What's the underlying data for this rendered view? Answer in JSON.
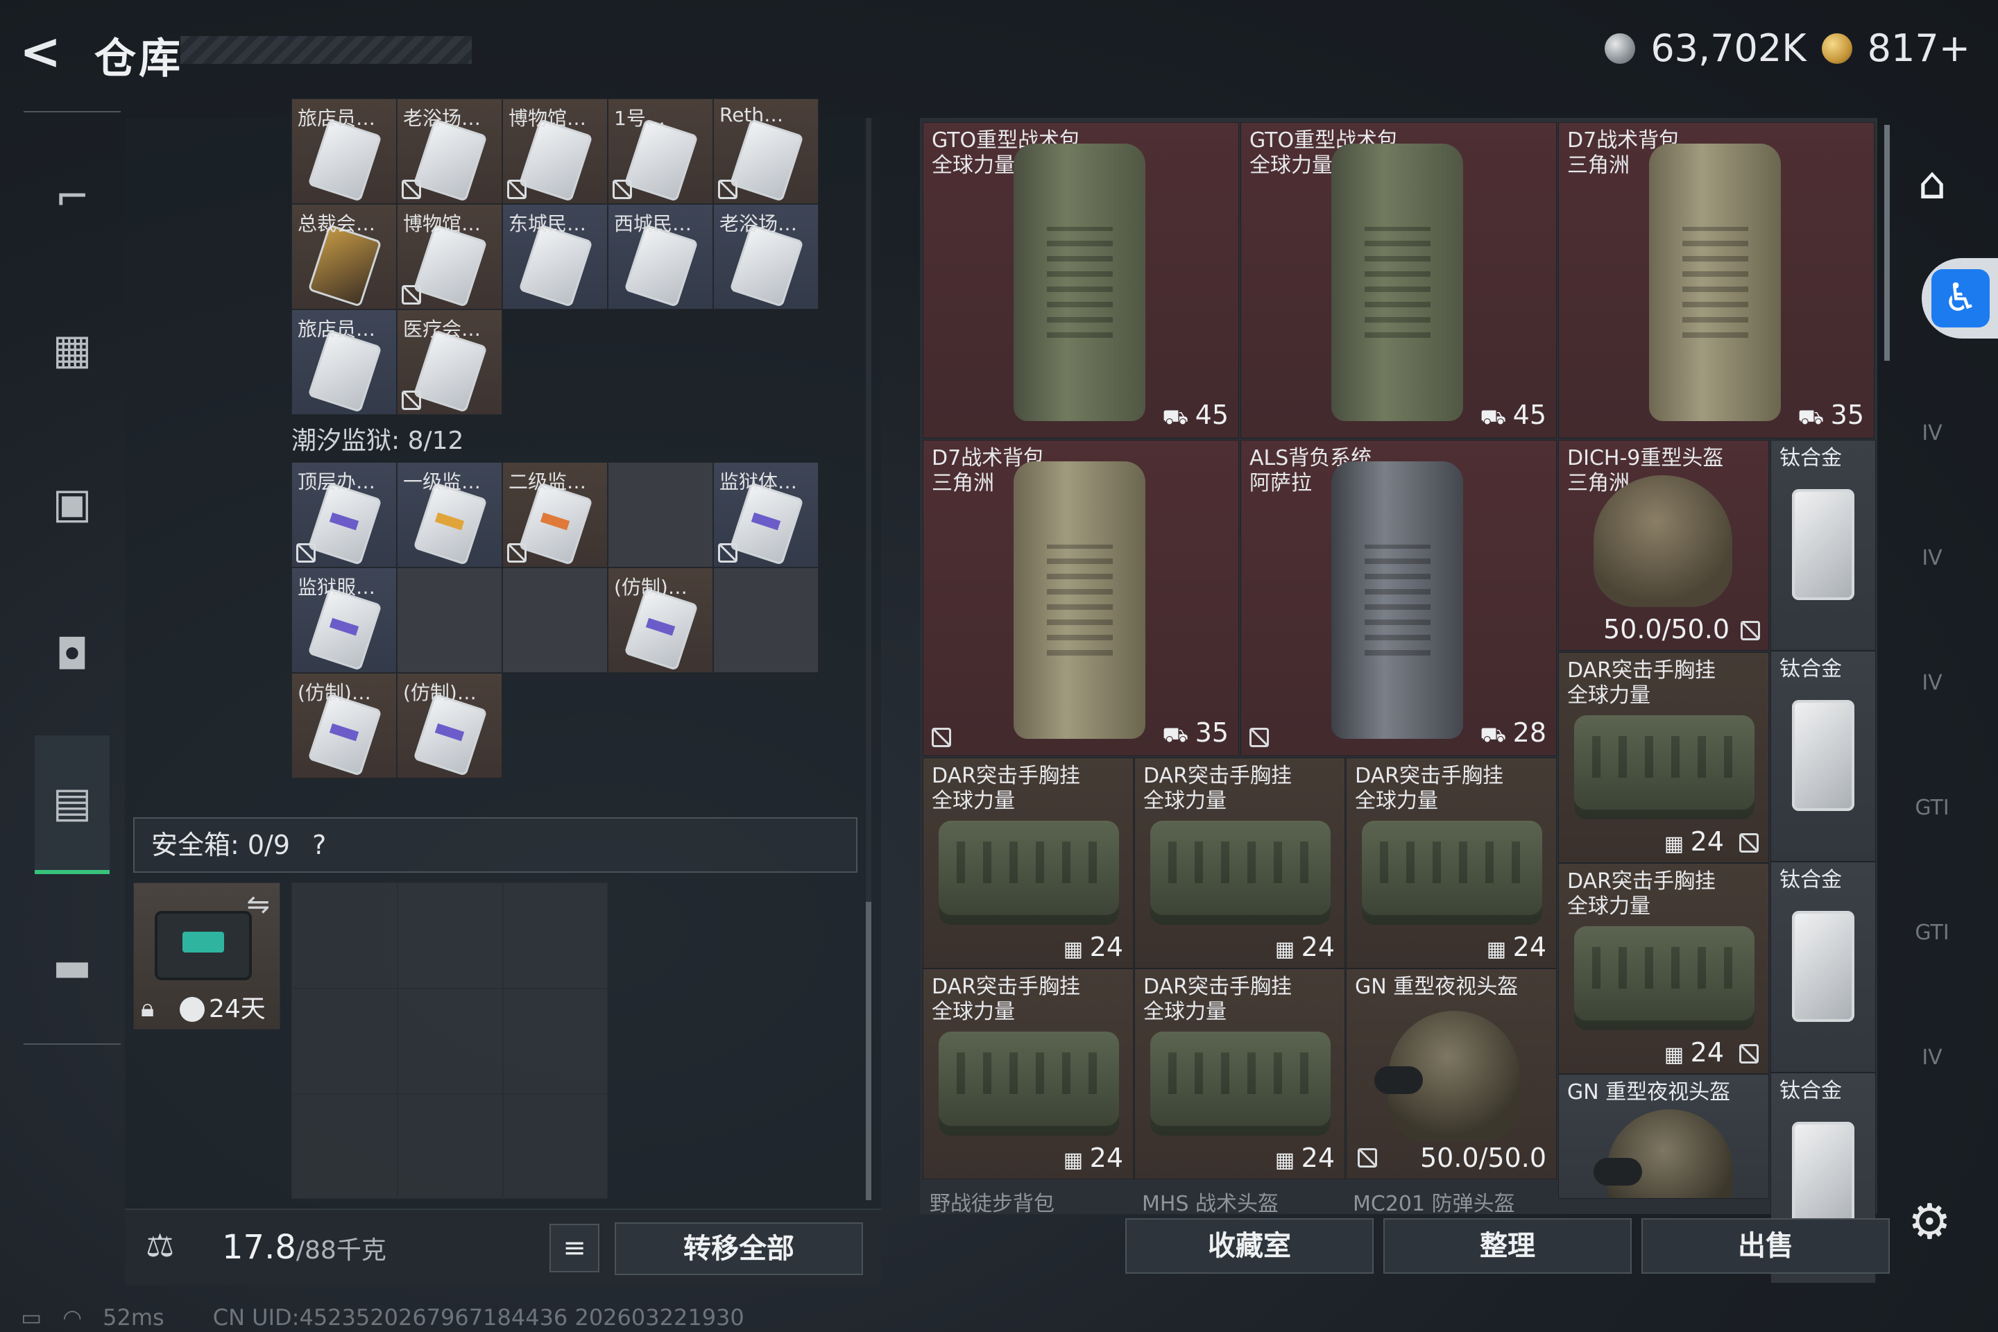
{
  "header": {
    "title": "仓库",
    "silver": "63,702K",
    "gold": "817+"
  },
  "left_nav": {
    "items": [
      "gun-icon",
      "vest-icon",
      "backpack-icon",
      "bag-icon",
      "case-icon",
      "toolbox-icon"
    ],
    "active": 4
  },
  "keycards": {
    "row1": [
      {
        "label": "旅店员…",
        "style": "brown",
        "nolock": false
      },
      {
        "label": "老浴场…",
        "style": "brown",
        "nolock": true
      },
      {
        "label": "博物馆…",
        "style": "brown",
        "nolock": true
      },
      {
        "label": "1号…",
        "style": "brown",
        "nolock": true
      },
      {
        "label": "Reth…",
        "style": "brown",
        "nolock": true
      }
    ],
    "row2": [
      {
        "label": "总裁会…",
        "style": "brown",
        "gold": true,
        "nolock": false
      },
      {
        "label": "博物馆…",
        "style": "brown",
        "nolock": true
      },
      {
        "label": "东城民…",
        "style": "blue",
        "nolock": false
      },
      {
        "label": "西城民…",
        "style": "blue",
        "nolock": false
      },
      {
        "label": "老浴场…",
        "style": "blue",
        "nolock": false
      }
    ],
    "row3": [
      {
        "label": "旅店员…",
        "style": "blue",
        "nolock": false
      },
      {
        "label": "医疗会…",
        "style": "brown",
        "nolock": true
      }
    ]
  },
  "prison": {
    "label": "潮汐监狱: 8/12",
    "row1": [
      {
        "label": "顶层办…",
        "style": "blue",
        "bar": "p",
        "nolock": true
      },
      {
        "label": "一级监…",
        "style": "blue",
        "bar": "y",
        "nolock": false
      },
      {
        "label": "二级监…",
        "style": "brown",
        "bar": "o",
        "nolock": true
      },
      {
        "label": "",
        "style": "empty"
      },
      {
        "label": "监狱体…",
        "style": "blue",
        "bar": "p",
        "nolock": true
      }
    ],
    "row2": [
      {
        "label": "监狱服…",
        "style": "blue",
        "bar": "p",
        "nolock": false
      },
      {
        "label": "",
        "style": "empty"
      },
      {
        "label": "",
        "style": "empty"
      },
      {
        "label": "(仿制)…",
        "style": "brown",
        "bar": "p",
        "nolock": false
      },
      {
        "label": "",
        "style": "empty"
      }
    ],
    "row3": [
      {
        "label": "(仿制)…",
        "style": "brown",
        "bar": "p",
        "nolock": false
      },
      {
        "label": "(仿制)…",
        "style": "brown",
        "bar": "p",
        "nolock": false
      }
    ]
  },
  "safebox": {
    "label": "安全箱: 0/9",
    "help": "?",
    "days": "24天"
  },
  "bottom_left": {
    "weight": "17.8",
    "capacity": "/88千克",
    "transfer": "转移全部",
    "list_icon": "≡"
  },
  "storage": {
    "backpacks_row1": [
      {
        "name": "GTO重型战术包\n全球力量",
        "count": "45"
      },
      {
        "name": "GTO重型战术包\n全球力量",
        "count": "45"
      },
      {
        "name": "D7战术背包\n三角洲",
        "count": "35"
      }
    ],
    "backpacks_row2": [
      {
        "name": "D7战术背包\n三角洲",
        "count": "35"
      },
      {
        "name": "ALS背负系统\n阿萨拉",
        "count": "28"
      }
    ],
    "helmet": {
      "name": "DICH-9重型头盔\n三角洲",
      "durability": "50.0/50.0"
    },
    "vests": [
      {
        "name": "DAR突击手胸挂\n全球力量",
        "count": "24"
      },
      {
        "name": "DAR突击手胸挂\n全球力量",
        "count": "24"
      },
      {
        "name": "DAR突击手胸挂\n全球力量",
        "count": "24"
      },
      {
        "name": "DAR突击手胸挂\n全球力量",
        "count": "24"
      },
      {
        "name": "DAR突击手胸挂\n全球力量",
        "count": "24"
      },
      {
        "name": "DAR突击手胸挂\n全球力量",
        "count": "24"
      },
      {
        "name": "DAR突击手胸挂\n全球力量",
        "count": "24"
      }
    ],
    "nvg_helmet": {
      "name": "GN 重型夜视头盔",
      "durability": "50.0/50.0"
    },
    "nvg_helmet2": {
      "name": "GN 重型夜视头盔"
    },
    "titanium": "钛合金",
    "partial": [
      "野战徒步背包",
      "MHS 战术头盔",
      "MC201 防弹头盔"
    ]
  },
  "bottom_right": {
    "collection": "收藏室",
    "sort": "整理",
    "sell": "出售"
  },
  "right_nav": {
    "items": [
      "IV",
      "IV",
      "IV",
      "IV",
      "GTI",
      "GTI",
      "IV"
    ]
  },
  "status": {
    "ping": "52ms",
    "uid": "CN UID:4523520267967184436 202603221930"
  }
}
